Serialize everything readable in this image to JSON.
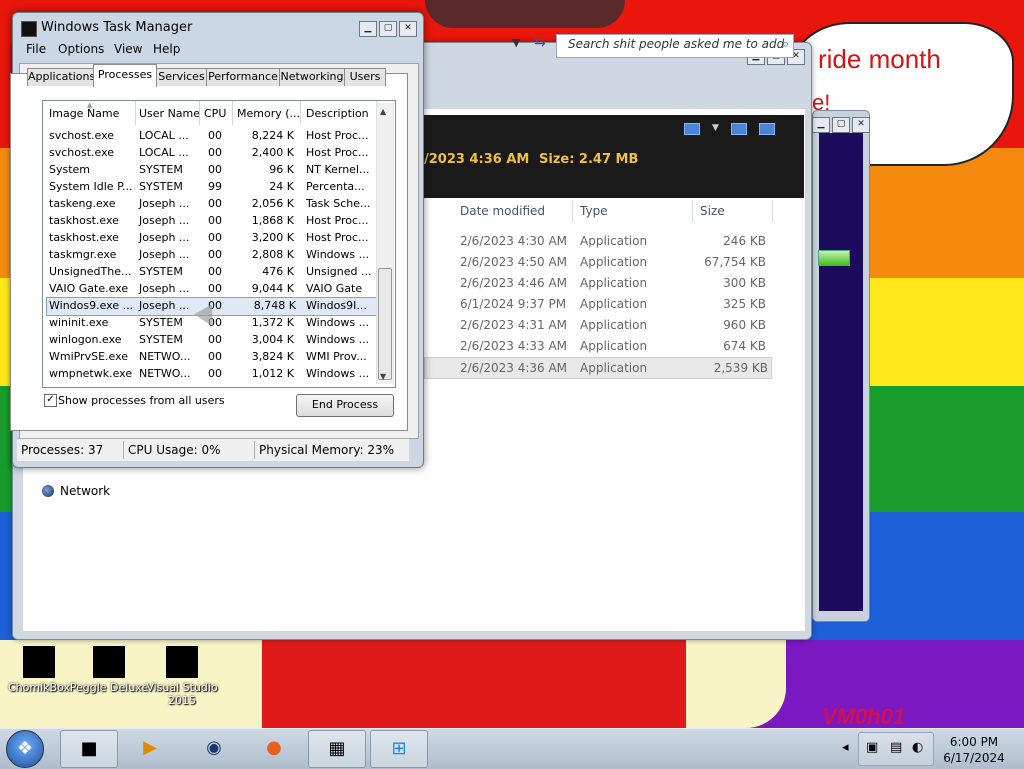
{
  "desktop": {
    "bubble_text": "ride month",
    "bubble_text2": "e!",
    "watermark": "VM0h01"
  },
  "explorer": {
    "search_placeholder": "Search shit people asked me to add",
    "header_date": "/2023 4:36 AM",
    "header_size": "Size: 2.47 MB",
    "columns": [
      "Date modified",
      "Type",
      "Size"
    ],
    "rows": [
      {
        "date": "2/6/2023 4:30 AM",
        "type": "Application",
        "size": "246 KB"
      },
      {
        "date": "2/6/2023 4:50 AM",
        "type": "Application",
        "size": "67,754 KB"
      },
      {
        "date": "2/6/2023 4:46 AM",
        "type": "Application",
        "size": "300 KB"
      },
      {
        "date": "6/1/2024 9:37 PM",
        "type": "Application",
        "size": "325 KB"
      },
      {
        "date": "2/6/2023 4:31 AM",
        "type": "Application",
        "size": "960 KB"
      },
      {
        "date": "2/6/2023 4:33 AM",
        "type": "Application",
        "size": "674 KB"
      },
      {
        "date": "2/6/2023 4:36 AM",
        "type": "Application",
        "size": "2,539 KB"
      }
    ],
    "network_label": "Network"
  },
  "taskmgr": {
    "title": "Windows Task Manager",
    "menu": [
      "File",
      "Options",
      "View",
      "Help"
    ],
    "tabs": [
      "Applications",
      "Processes",
      "Services",
      "Performance",
      "Networking",
      "Users"
    ],
    "active_tab": "Processes",
    "columns": [
      "Image Name",
      "User Name",
      "CPU",
      "Memory (...",
      "Description"
    ],
    "processes": [
      {
        "name": "svchost.exe",
        "user": "LOCAL ...",
        "cpu": "00",
        "mem": "8,224 K",
        "desc": "Host Proc..."
      },
      {
        "name": "svchost.exe",
        "user": "LOCAL ...",
        "cpu": "00",
        "mem": "2,400 K",
        "desc": "Host Proc..."
      },
      {
        "name": "System",
        "user": "SYSTEM",
        "cpu": "00",
        "mem": "96 K",
        "desc": "NT Kernel..."
      },
      {
        "name": "System Idle P...",
        "user": "SYSTEM",
        "cpu": "99",
        "mem": "24 K",
        "desc": "Percenta..."
      },
      {
        "name": "taskeng.exe",
        "user": "Joseph ...",
        "cpu": "00",
        "mem": "2,056 K",
        "desc": "Task Sche..."
      },
      {
        "name": "taskhost.exe",
        "user": "Joseph ...",
        "cpu": "00",
        "mem": "1,868 K",
        "desc": "Host Proc..."
      },
      {
        "name": "taskhost.exe",
        "user": "Joseph ...",
        "cpu": "00",
        "mem": "3,200 K",
        "desc": "Host Proc..."
      },
      {
        "name": "taskmgr.exe",
        "user": "Joseph ...",
        "cpu": "00",
        "mem": "2,808 K",
        "desc": "Windows ..."
      },
      {
        "name": "UnsignedThe...",
        "user": "SYSTEM",
        "cpu": "00",
        "mem": "476 K",
        "desc": "Unsigned ..."
      },
      {
        "name": "VAIO Gate.exe",
        "user": "Joseph ...",
        "cpu": "00",
        "mem": "9,044 K",
        "desc": "VAIO Gate"
      },
      {
        "name": "Windos9.exe ...",
        "user": "Joseph ...",
        "cpu": "00",
        "mem": "8,748 K",
        "desc": "Windos9I..."
      },
      {
        "name": "wininit.exe",
        "user": "SYSTEM",
        "cpu": "00",
        "mem": "1,372 K",
        "desc": "Windows ..."
      },
      {
        "name": "winlogon.exe",
        "user": "SYSTEM",
        "cpu": "00",
        "mem": "3,004 K",
        "desc": "Windows ..."
      },
      {
        "name": "WmiPrvSE.exe",
        "user": "NETWO...",
        "cpu": "00",
        "mem": "3,824 K",
        "desc": "WMI Prov..."
      },
      {
        "name": "wmpnetwk.exe",
        "user": "NETWO...",
        "cpu": "00",
        "mem": "1,012 K",
        "desc": "Windows ..."
      }
    ],
    "selected_index": 10,
    "show_all_label": "Show processes from all users",
    "show_all_checked": "✓",
    "end_process_label": "End Process",
    "status": {
      "processes": "Processes: 37",
      "cpu": "CPU Usage: 0%",
      "memory": "Physical Memory: 23%"
    }
  },
  "desktop_icons": [
    {
      "label": "ChomikBox"
    },
    {
      "label": "Peggle Deluxe"
    },
    {
      "label": "Visual Studio 2015"
    }
  ],
  "taskbar": {
    "time": "6:00 PM",
    "date": "6/17/2024"
  }
}
